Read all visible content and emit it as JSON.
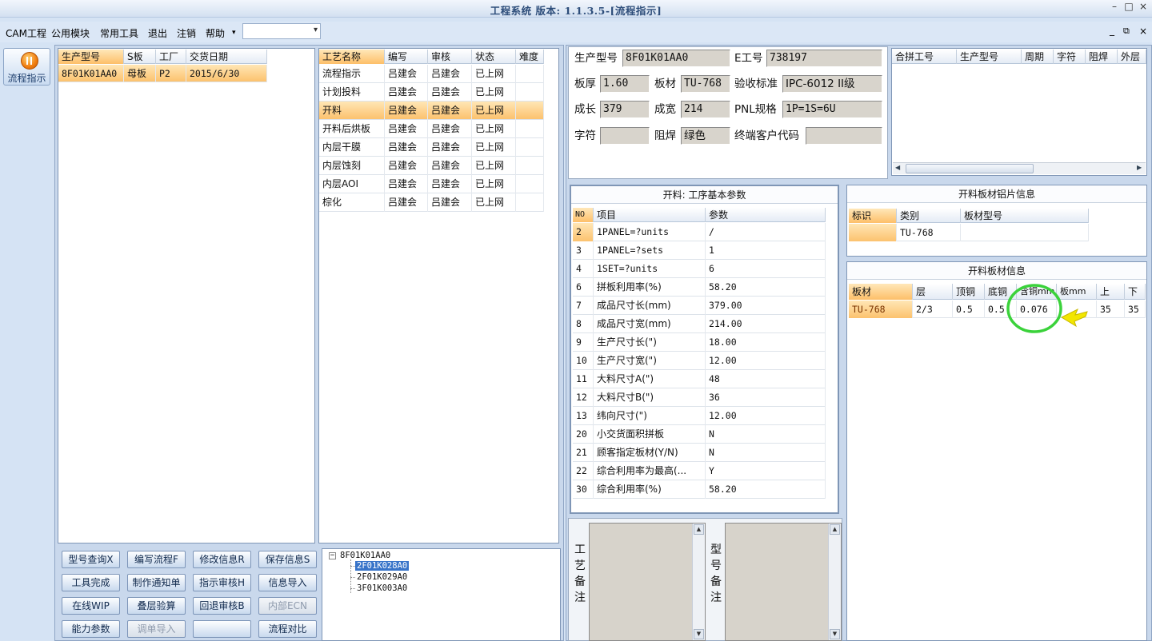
{
  "window": {
    "title": "工程系统 版本: 1.1.3.5-[流程指示]",
    "controls": [
      "–",
      "□",
      "×"
    ],
    "mdi_controls": [
      "_",
      "⧉",
      "×"
    ]
  },
  "menu": {
    "items": [
      "CAM工程",
      "公用模块",
      "常用工具",
      "退出",
      "注销",
      "帮助"
    ],
    "combo_value": ""
  },
  "sidebar": {
    "button_label": "流程指示"
  },
  "orders": {
    "columns": [
      "生产型号",
      "S板",
      "工厂",
      "交货日期"
    ],
    "rows": [
      [
        "8F01K01AA0",
        "母板",
        "P2",
        "2015/6/30"
      ]
    ]
  },
  "process": {
    "columns": [
      "工艺名称",
      "编写",
      "审核",
      "状态",
      "难度"
    ],
    "rows": [
      [
        "流程指示",
        "吕建会",
        "吕建会",
        "已上网",
        ""
      ],
      [
        "计划投料",
        "吕建会",
        "吕建会",
        "已上网",
        ""
      ],
      [
        "开料",
        "吕建会",
        "吕建会",
        "已上网",
        ""
      ],
      [
        "开料后烘板",
        "吕建会",
        "吕建会",
        "已上网",
        ""
      ],
      [
        "内层干膜",
        "吕建会",
        "吕建会",
        "已上网",
        ""
      ],
      [
        "内层蚀刻",
        "吕建会",
        "吕建会",
        "已上网",
        ""
      ],
      [
        "内层AOI",
        "吕建会",
        "吕建会",
        "已上网",
        ""
      ],
      [
        "棕化",
        "吕建会",
        "吕建会",
        "已上网",
        ""
      ]
    ],
    "selected_index": 2
  },
  "buttons": [
    [
      "型号查询X",
      "编写流程F",
      "修改信息R",
      "保存信息S"
    ],
    [
      "工具完成",
      "制作通知单",
      "指示审核H",
      "信息导入"
    ],
    [
      "在线WIP",
      "叠层验算",
      "回退审核B",
      "内部ECN"
    ],
    [
      "能力参数",
      "调单导入",
      "",
      "流程对比"
    ]
  ],
  "disabled_buttons": [
    "内部ECN",
    "调单导入"
  ],
  "tree": {
    "root": "8F01K01AA0",
    "children": [
      "2F01K028A0",
      "2F01K029A0",
      "3F01K003A0"
    ],
    "selected": "2F01K028A0"
  },
  "info": {
    "labels": {
      "model": "生产型号",
      "e_no": "E工号",
      "thickness": "板厚",
      "material": "板材",
      "standard": "验收标准",
      "length": "成长",
      "width": "成宽",
      "pnl": "PNL规格",
      "char": "字符",
      "mask": "阻焊",
      "customer": "终端客户代码"
    },
    "values": {
      "model": "8F01K01AA0",
      "e_no": "738197",
      "thickness": "1.60",
      "material": "TU-768",
      "standard": "IPC-6012 II级",
      "length": "379",
      "width": "214",
      "pnl": "1P=1S=6U",
      "char": "",
      "mask": "绿色",
      "customer": ""
    }
  },
  "merge": {
    "columns": [
      "合拼工号",
      "生产型号",
      "周期",
      "字符",
      "阻焊",
      "外层"
    ],
    "scroll_arrows": [
      "◀",
      "▶"
    ]
  },
  "params": {
    "title": "开料: 工序基本参数",
    "columns": [
      "NO",
      "项目",
      "参数"
    ],
    "rows": [
      [
        "2",
        "1PANEL=?units",
        "/"
      ],
      [
        "3",
        "1PANEL=?sets",
        "1"
      ],
      [
        "4",
        "1SET=?units",
        "6"
      ],
      [
        "6",
        "拼板利用率(%)",
        "58.20"
      ],
      [
        "7",
        "成品尺寸长(mm)",
        "379.00"
      ],
      [
        "8",
        "成品尺寸宽(mm)",
        "214.00"
      ],
      [
        "9",
        "生产尺寸长(\")",
        "18.00"
      ],
      [
        "10",
        "生产尺寸宽(\")",
        "12.00"
      ],
      [
        "11",
        "大料尺寸A(\")",
        "48"
      ],
      [
        "12",
        "大料尺寸B(\")",
        "36"
      ],
      [
        "13",
        "纬向尺寸(\")",
        "12.00"
      ],
      [
        "20",
        "小交货面积拼板",
        "N"
      ],
      [
        "21",
        "顾客指定板材(Y/N)",
        "N"
      ],
      [
        "22",
        "综合利用率为最高(...",
        "Y"
      ],
      [
        "30",
        "综合利用率(%)",
        "58.20"
      ]
    ]
  },
  "foil": {
    "title": "开料板材铝片信息",
    "columns": [
      "标识",
      "类别",
      "板材型号"
    ],
    "rows": [
      [
        "",
        "TU-768",
        ""
      ]
    ]
  },
  "board": {
    "title": "开料板材信息",
    "columns": [
      "板材",
      "层",
      "顶铜",
      "底铜",
      "含铜mm",
      "板mm",
      "上",
      "下"
    ],
    "rows": [
      [
        "TU-768",
        "2/3",
        "0.5",
        "0.5",
        "0.076",
        "",
        "35",
        "35"
      ]
    ]
  },
  "notes": {
    "process_label": [
      "工",
      "艺",
      "备",
      "注"
    ],
    "model_label": [
      "型",
      "号",
      "备",
      "注"
    ],
    "scroll_arrows": [
      "▲",
      "▼"
    ]
  },
  "colors": {
    "selection": "#fcc26e",
    "highlight_circle": "#3bd23b",
    "pointer": "#f2e600"
  }
}
